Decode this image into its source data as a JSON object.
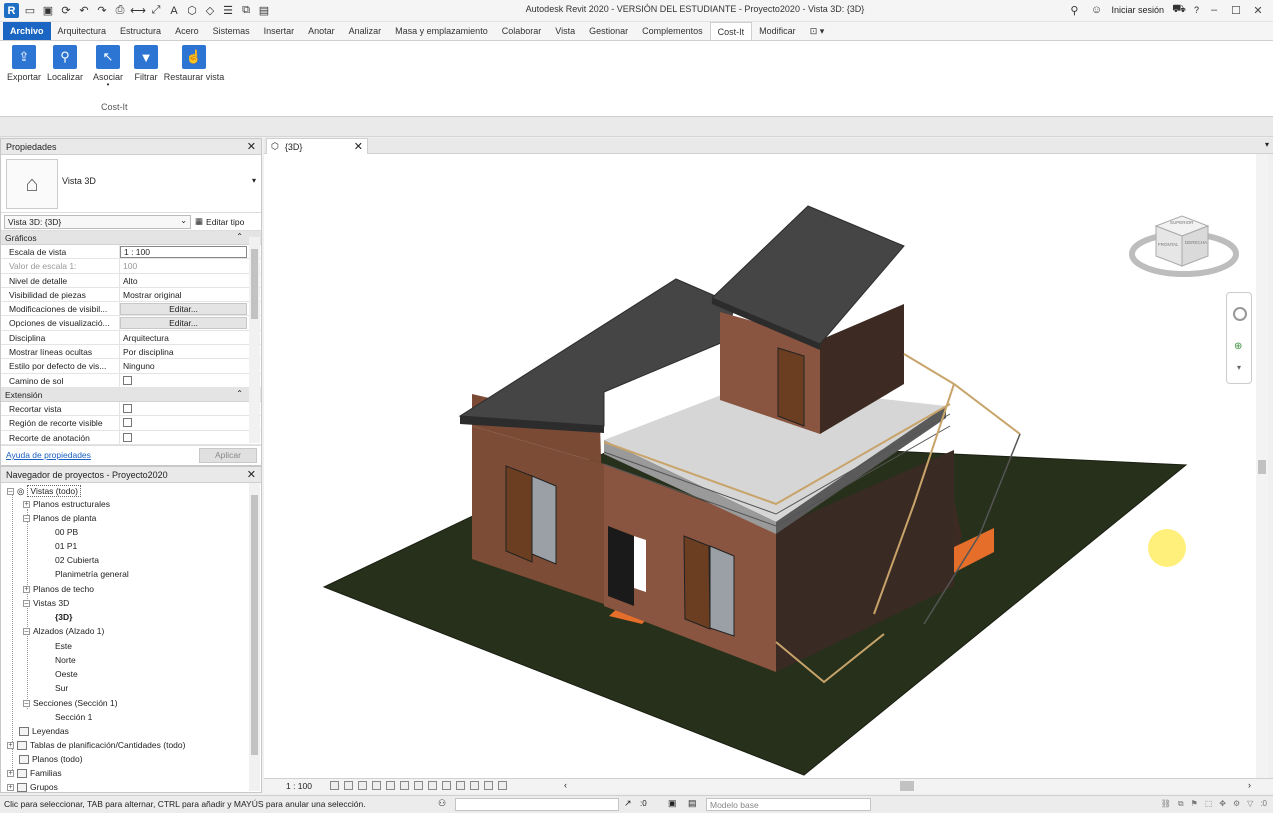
{
  "window": {
    "title": "Autodesk Revit 2020 - VERSIÓN DEL ESTUDIANTE - Proyecto2020 - Vista 3D: {3D}",
    "signin": "Iniciar sesión",
    "help": "?"
  },
  "ribbon": {
    "tabs": [
      "Archivo",
      "Arquitectura",
      "Estructura",
      "Acero",
      "Sistemas",
      "Insertar",
      "Anotar",
      "Analizar",
      "Masa y emplazamiento",
      "Colaborar",
      "Vista",
      "Gestionar",
      "Complementos",
      "Cost-It",
      "Modificar"
    ],
    "buttons": [
      "Exportar",
      "Localizar",
      "Asociar",
      "Filtrar",
      "Restaurar vista"
    ],
    "panel_label": "Cost-It"
  },
  "properties": {
    "title": "Propiedades",
    "type_name": "Vista 3D",
    "instance": "Vista 3D: {3D}",
    "edit_type": "Editar tipo",
    "sections": [
      "Gráficos",
      "Extensión"
    ],
    "rows": [
      {
        "k": "Escala de vista",
        "v": "1 : 100"
      },
      {
        "k": "Valor de escala    1:",
        "v": "100"
      },
      {
        "k": "Nivel de detalle",
        "v": "Alto"
      },
      {
        "k": "Visibilidad de piezas",
        "v": "Mostrar original"
      },
      {
        "k": "Modificaciones de visibil...",
        "v": "Editar..."
      },
      {
        "k": "Opciones de visualizació...",
        "v": "Editar..."
      },
      {
        "k": "Disciplina",
        "v": "Arquitectura"
      },
      {
        "k": "Mostrar líneas ocultas",
        "v": "Por disciplina"
      },
      {
        "k": "Estilo por defecto de vis...",
        "v": "Ninguno"
      },
      {
        "k": "Camino de sol",
        "v": ""
      }
    ],
    "ext_rows": [
      {
        "k": "Recortar vista"
      },
      {
        "k": "Región de recorte visible"
      },
      {
        "k": "Recorte de anotación"
      }
    ],
    "help_link": "Ayuda de propiedades",
    "apply": "Aplicar"
  },
  "browser": {
    "title": "Navegador de proyectos - Proyecto2020",
    "nodes": [
      "Vistas (todo)",
      "Planos estructurales",
      "Planos de planta",
      "00 PB",
      "01 P1",
      "02 Cubierta",
      "Planimetría general",
      "Planos de techo",
      "Vistas 3D",
      "{3D}",
      "Alzados (Alzado 1)",
      "Este",
      "Norte",
      "Oeste",
      "Sur",
      "Secciones (Sección 1)",
      "Sección 1",
      "Leyendas",
      "Tablas de planificación/Cantidades (todo)",
      "Planos (todo)",
      "Familias",
      "Grupos"
    ]
  },
  "view": {
    "tab_label": "{3D}",
    "scale": "1 : 100",
    "viewcube_faces": [
      "SUPERIOR",
      "FRONTAL",
      "DERECHA"
    ]
  },
  "status": {
    "message": "Clic para seleccionar, TAB para alternar, CTRL para añadir y MAYÚS para anular una selección.",
    "filter_count": ":0",
    "model": "Modelo base",
    "right_count": ":0"
  },
  "colors": {
    "archivo_tab": "#1a66c2",
    "ground": "#27301a",
    "brick": "#7a4a35",
    "roof": "#454545",
    "deck": "#d6d6d6",
    "floor_orange": "#e56f2a",
    "cursor_highlight": "#ffeb50"
  }
}
